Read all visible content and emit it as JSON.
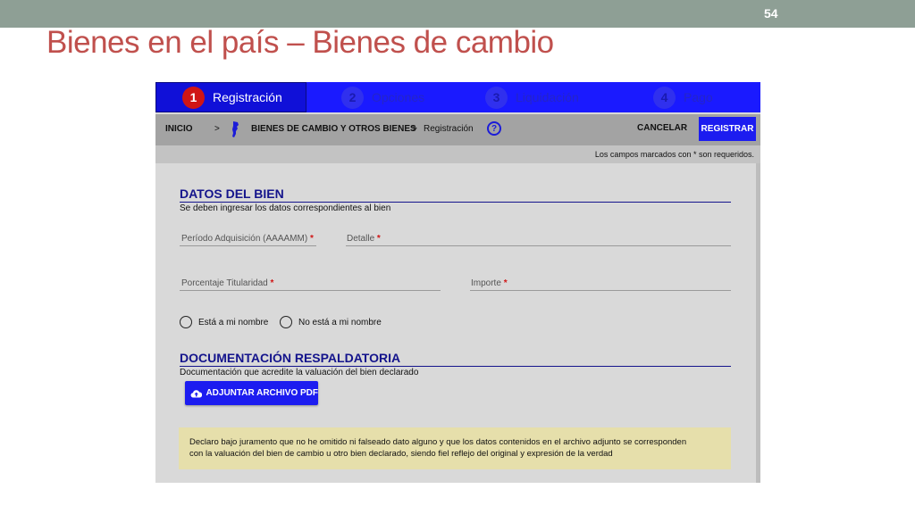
{
  "slide": {
    "number": "54",
    "title": "Bienes en el país – Bienes de cambio"
  },
  "colors": {
    "title_red": "#c0504d",
    "step_blue": "#1a1aff",
    "primary_button": "#1c1cf0",
    "required_red": "#d01515",
    "section_title": "#14148c",
    "declaration_bg": "#e6dfab"
  },
  "steps": [
    {
      "number": "1",
      "label": "Registración",
      "active": true
    },
    {
      "number": "2",
      "label": "Opciones",
      "active": false
    },
    {
      "number": "3",
      "label": "Liquidación",
      "active": false
    },
    {
      "number": "4",
      "label": "Pago",
      "active": false
    }
  ],
  "toolbar": {
    "home": "INICIO",
    "separator": ">",
    "map_icon": "argentina-map-icon",
    "section": "BIENES DE CAMBIO Y OTROS BIENES",
    "current": "Registración",
    "help_icon": "help-icon",
    "help_glyph": "?",
    "cancel": "CANCELAR",
    "register": "REGISTRAR"
  },
  "notice": "Los campos marcados con * son requeridos.",
  "datos": {
    "title": "DATOS DEL BIEN",
    "subtitle": "Se deben ingresar los datos correspondientes al bien",
    "required_mark": "*",
    "fields": {
      "periodo": "Período Adquisición (AAAAMM)",
      "detalle": "Detalle",
      "porcentaje": "Porcentaje Titularidad",
      "importe": "Importe"
    },
    "radios": [
      "Está a mi nombre",
      "No está a mi nombre"
    ]
  },
  "documentacion": {
    "title": "DOCUMENTACIÓN RESPALDATORIA",
    "subtitle": "Documentación que acredite la valuación del bien declarado",
    "attach_button": "ADJUNTAR ARCHIVO PDF",
    "attach_icon": "cloud-upload-icon"
  },
  "declaration": {
    "line1": "Declaro bajo juramento que no he omitido ni falseado dato alguno  y que  los datos contenidos en el archivo adjunto se corresponden",
    "line2": "con la valuación del bien de cambio u otro bien declarado, siendo fiel reflejo del original y expresión de la verdad"
  }
}
